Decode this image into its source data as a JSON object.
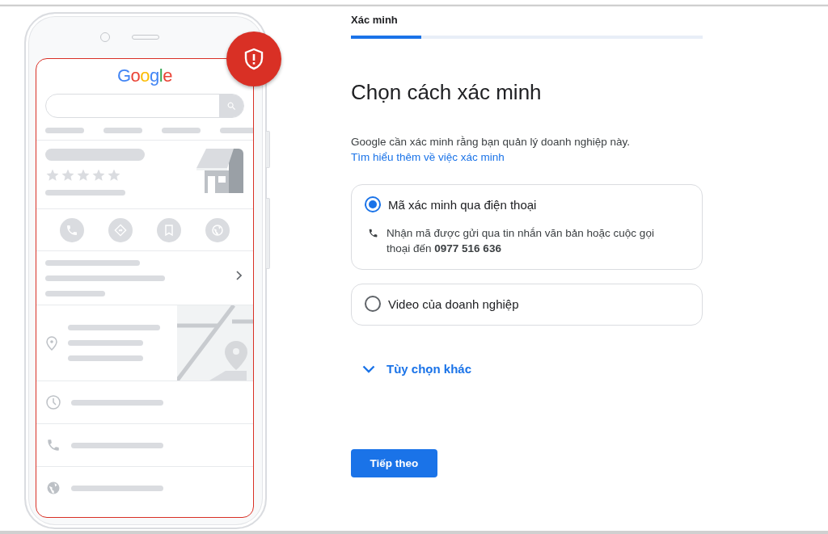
{
  "phone_preview": {
    "logo": "Google"
  },
  "progress": {
    "step_label": "Xác minh",
    "level": 0.2
  },
  "heading": "Chọn cách xác minh",
  "description": "Google cần xác minh rằng bạn quản lý doanh nghiệp này.",
  "learn_more_link": "Tìm hiểu thêm về việc xác minh",
  "options": [
    {
      "label": "Mã xác minh qua điện thoại",
      "selected": true,
      "detail": "Nhận mã được gửi qua tin nhắn văn bản hoặc cuộc gọi thoại đến **0977 516 636**"
    },
    {
      "label": "Video của doanh nghiệp",
      "selected": false
    }
  ],
  "more_options": {
    "label": "Tùy chọn khác",
    "expanded": false
  },
  "next_button": "Tiếp theo"
}
